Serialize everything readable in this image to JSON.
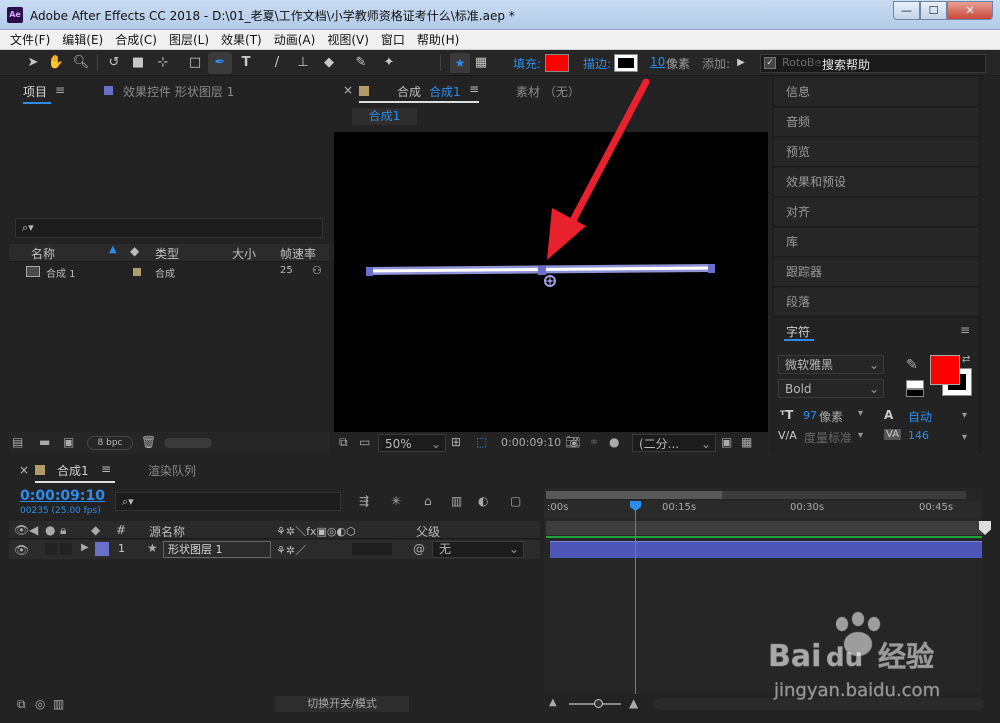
{
  "window": {
    "app_icon": "Ae",
    "title": "Adobe After Effects CC 2018 - D:\\01_老夏\\工作文档\\小学教师资格证考什么\\标准.aep *",
    "minimize": "—",
    "maximize": "☐",
    "close": "✕"
  },
  "menu": [
    "文件(F)",
    "编辑(E)",
    "合成(C)",
    "图层(L)",
    "效果(T)",
    "动画(A)",
    "视图(V)",
    "窗口",
    "帮助(H)"
  ],
  "toolbar": {
    "fill_label": "填充:",
    "stroke_label": "描边:",
    "stroke_width": "10",
    "stroke_unit": "像素",
    "add_label": "添加:",
    "rotobezier": "RotoBe",
    "search_help": "搜索帮助",
    "fill_color": "#ff0000",
    "accent": "#2d8ceb"
  },
  "project_panel": {
    "tab_project": "项目",
    "tab_effects": "效果控件 形状图层 1",
    "columns": [
      "名称",
      "类型",
      "大小",
      "帧速率"
    ],
    "rows": [
      {
        "name": "合成 1",
        "type": "合成",
        "size": "",
        "fps": "25"
      }
    ],
    "bpc": "8 bpc"
  },
  "comp_panel": {
    "tab_label": "合成",
    "tab_comp": "合成1",
    "tab_footage": "素材 （无）",
    "breadcrumb": "合成1",
    "zoom": "50%",
    "timecode": "0:00:09:10",
    "resolution": "(二分..."
  },
  "right_panel": {
    "items": [
      "信息",
      "音频",
      "预览",
      "效果和预设",
      "对齐",
      "库",
      "跟踪器",
      "段落"
    ],
    "character_title": "字符",
    "font": "微软雅黑",
    "style": "Bold",
    "size_value": "97",
    "size_unit": "像素",
    "leading": "自动",
    "kerning": "度量标准",
    "tracking": "146"
  },
  "timeline": {
    "tab_comp": "合成1",
    "tab_render": "渲染队列",
    "timecode": "0:00:09:10",
    "frames": "00235 (25.00 fps)",
    "col_num": "#",
    "col_source": "源名称",
    "col_parent": "父级",
    "layer_index": "1",
    "layer_name": "形状图层 1",
    "parent_value": "无",
    "ruler": [
      ":00s",
      "00:15s",
      "00:30s",
      "00:45s"
    ],
    "toggle_label": "切换开关/模式",
    "current_time_fraction": 0.208
  },
  "watermark": {
    "brand": "Bai 经验",
    "url": "jingyan.baidu.com"
  }
}
